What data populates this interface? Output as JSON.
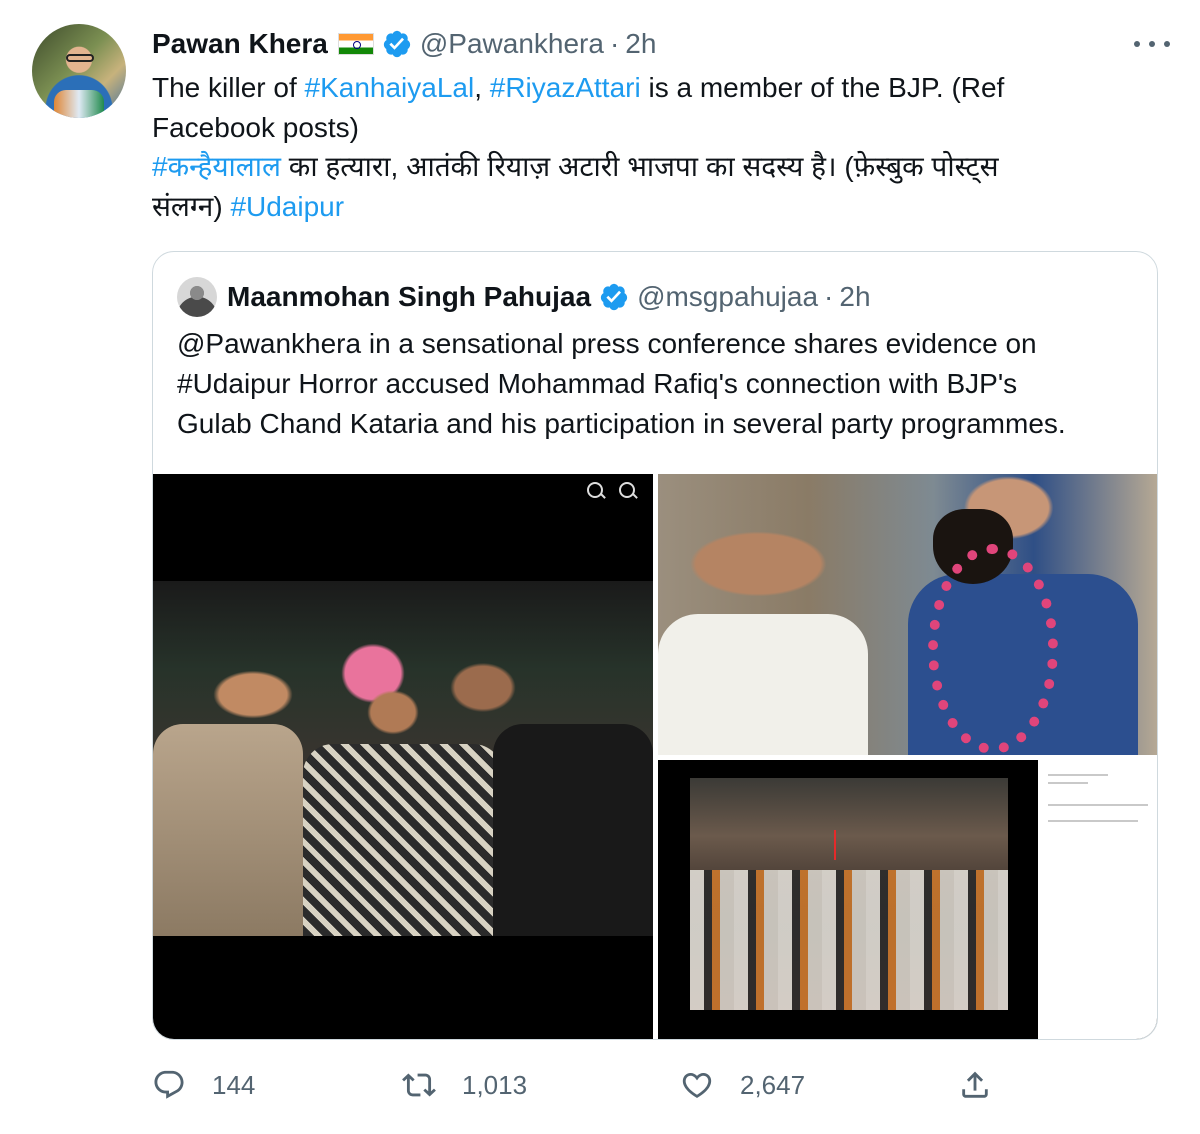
{
  "tweet": {
    "author": {
      "name": "Pawan Khera",
      "flag_icon": "india-flag-icon",
      "handle": "@Pawankhera",
      "time": "2h"
    },
    "text": {
      "line1_a": "The killer of ",
      "line1_tag1": "#KanhaiyaLal",
      "line1_b": ", ",
      "line1_tag2": "#RiyazAttari",
      "line1_c": " is a member of the BJP. (Ref",
      "line2": "Facebook posts)",
      "line3_tag": "#कन्हैयालाल",
      "line3_rest": " का हत्यारा, आतंकी रियाज़ अटारी भाजपा का सदस्य है। (फ़ेस्बुक पोस्ट्स",
      "line4_a": "संलग्न) ",
      "line4_tag": "#Udaipur"
    }
  },
  "quote": {
    "author": {
      "name": "Maanmohan Singh Pahujaa",
      "handle": "@msgpahujaa",
      "time": "2h"
    },
    "text": {
      "line1": "@Pawankhera in a sensational press conference shares evidence on",
      "line2": "#Udaipur Horror accused Mohammad Rafiq's connection with BJP's",
      "line3": "Gulab Chand Kataria and his participation in several party programmes."
    }
  },
  "actions": {
    "reply_count": "144",
    "retweet_count": "1,013",
    "like_count": "2,647"
  },
  "colors": {
    "link": "#1d9bf0",
    "secondary": "#536471",
    "border": "#cfd9de"
  }
}
